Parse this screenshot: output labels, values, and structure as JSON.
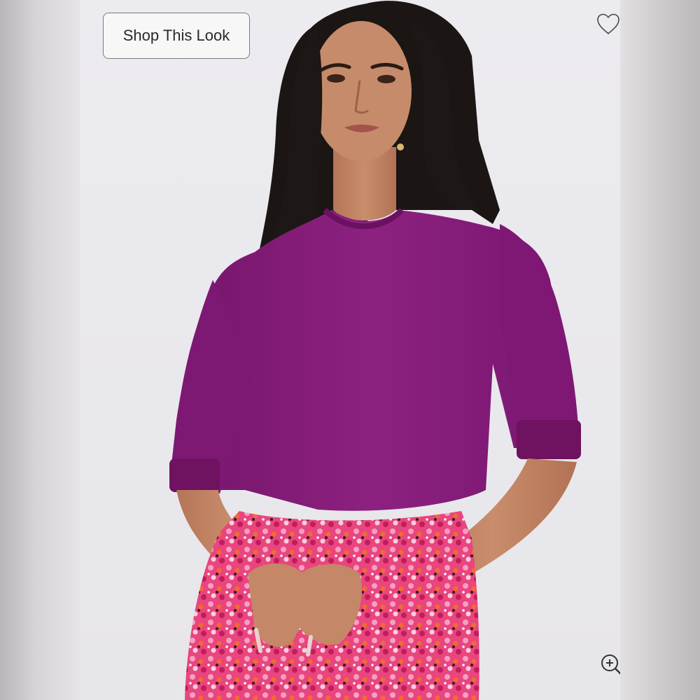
{
  "shop_button": {
    "label": "Shop This Look"
  },
  "icons": {
    "favorite": "heart-outline-icon",
    "zoom": "zoom-in-icon"
  },
  "colors": {
    "sweater": "#8a1f7c",
    "hair": "#1b1514",
    "skin": "#c58a69",
    "skirt_pink": "#e8457e",
    "background": "#ebeaee"
  }
}
